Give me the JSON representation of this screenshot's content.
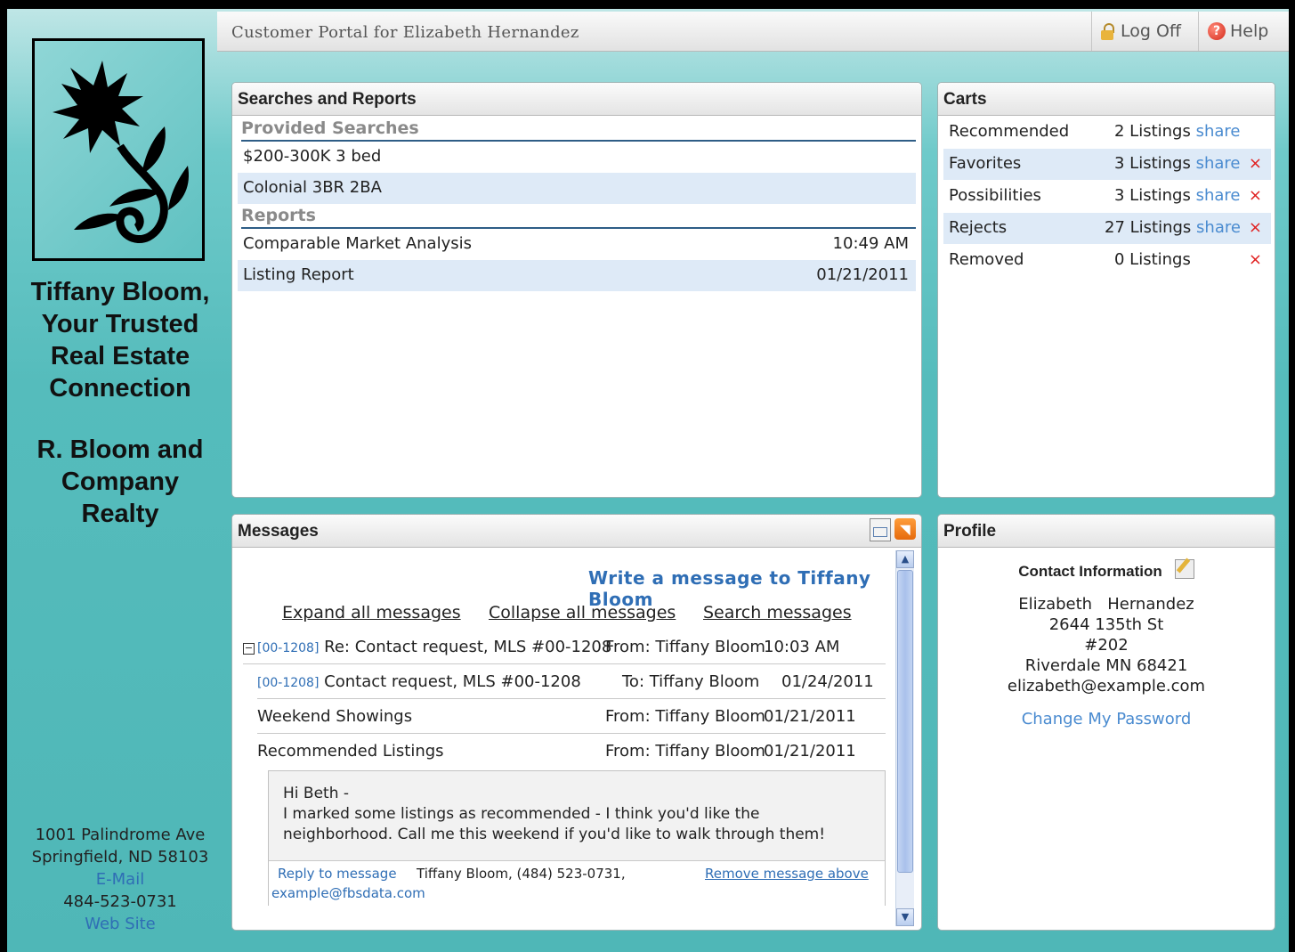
{
  "header": {
    "title": "Customer Portal for Elizabeth Hernandez",
    "logoff": "Log Off",
    "help": "Help"
  },
  "sidebar": {
    "tagline": [
      "Tiffany Bloom,",
      "Your Trusted",
      "Real Estate",
      "Connection"
    ],
    "company": [
      "R. Bloom and",
      "Company",
      "Realty"
    ],
    "address": {
      "street": "1001 Palindrome Ave",
      "city": "Springfield, ND 58103",
      "email": "E-Mail",
      "phone": "484-523-0731",
      "website": "Web Site"
    }
  },
  "searches": {
    "title": "Searches and Reports",
    "provided_label": "Provided Searches",
    "provided": [
      {
        "name": "$200-300K 3 bed"
      },
      {
        "name": "Colonial 3BR 2BA"
      }
    ],
    "reports_label": "Reports",
    "reports": [
      {
        "name": "Comparable Market Analysis",
        "time": "10:49 AM"
      },
      {
        "name": "Listing Report",
        "time": "01/21/2011"
      }
    ]
  },
  "carts": {
    "title": "Carts",
    "items": [
      {
        "name": "Recommended",
        "count": "2 Listings",
        "share": "share",
        "remove": ""
      },
      {
        "name": "Favorites",
        "count": "3 Listings",
        "share": "share",
        "remove": "×"
      },
      {
        "name": "Possibilities",
        "count": "3 Listings",
        "share": "share",
        "remove": "×"
      },
      {
        "name": "Rejects",
        "count": "27 Listings",
        "share": "share",
        "remove": "×"
      },
      {
        "name": "Removed",
        "count": "0 Listings",
        "share": "",
        "remove": "×"
      }
    ]
  },
  "messages": {
    "title": "Messages",
    "write": "Write a message to Tiffany Bloom",
    "expand": "Expand all messages",
    "collapse": "Collapse all messages",
    "search": "Search messages",
    "rows": [
      {
        "toggle": "−",
        "tag": "[00-1208]",
        "subject": "Re: Contact request, MLS #00-1208",
        "party": "From: Tiffany Bloom",
        "date": "10:03 AM"
      },
      {
        "tag": "[00-1208]",
        "subject": "Contact request, MLS #00-1208",
        "party": "To: Tiffany Bloom",
        "date": "01/24/2011"
      },
      {
        "subject": "Weekend Showings",
        "party": "From: Tiffany Bloom",
        "date": "01/21/2011"
      },
      {
        "subject": "Recommended Listings",
        "party": "From: Tiffany Bloom",
        "date": "01/21/2011"
      }
    ],
    "expanded": {
      "greeting": "Hi Beth -",
      "line1": "I marked some listings as recommended - I think you'd like the",
      "line2": "neighborhood. Call me this weekend if you'd like to walk through them!",
      "reply": "Reply to message",
      "sender": "Tiffany Bloom, (484) 523-0731,",
      "email": "example@fbsdata.com",
      "remove": "Remove message above"
    }
  },
  "profile": {
    "title": "Profile",
    "contact_head": "Contact Information",
    "name": "Elizabeth   Hernandez",
    "street": "2644 135th St",
    "unit": "#202",
    "city": "Riverdale MN 68421",
    "email": "elizabeth@example.com",
    "change_password": "Change My Password"
  },
  "colors": {
    "accent": "#2f6eb5",
    "teal": "#55bcbc",
    "row_alt": "#deeaf7",
    "remove": "#e02020"
  }
}
